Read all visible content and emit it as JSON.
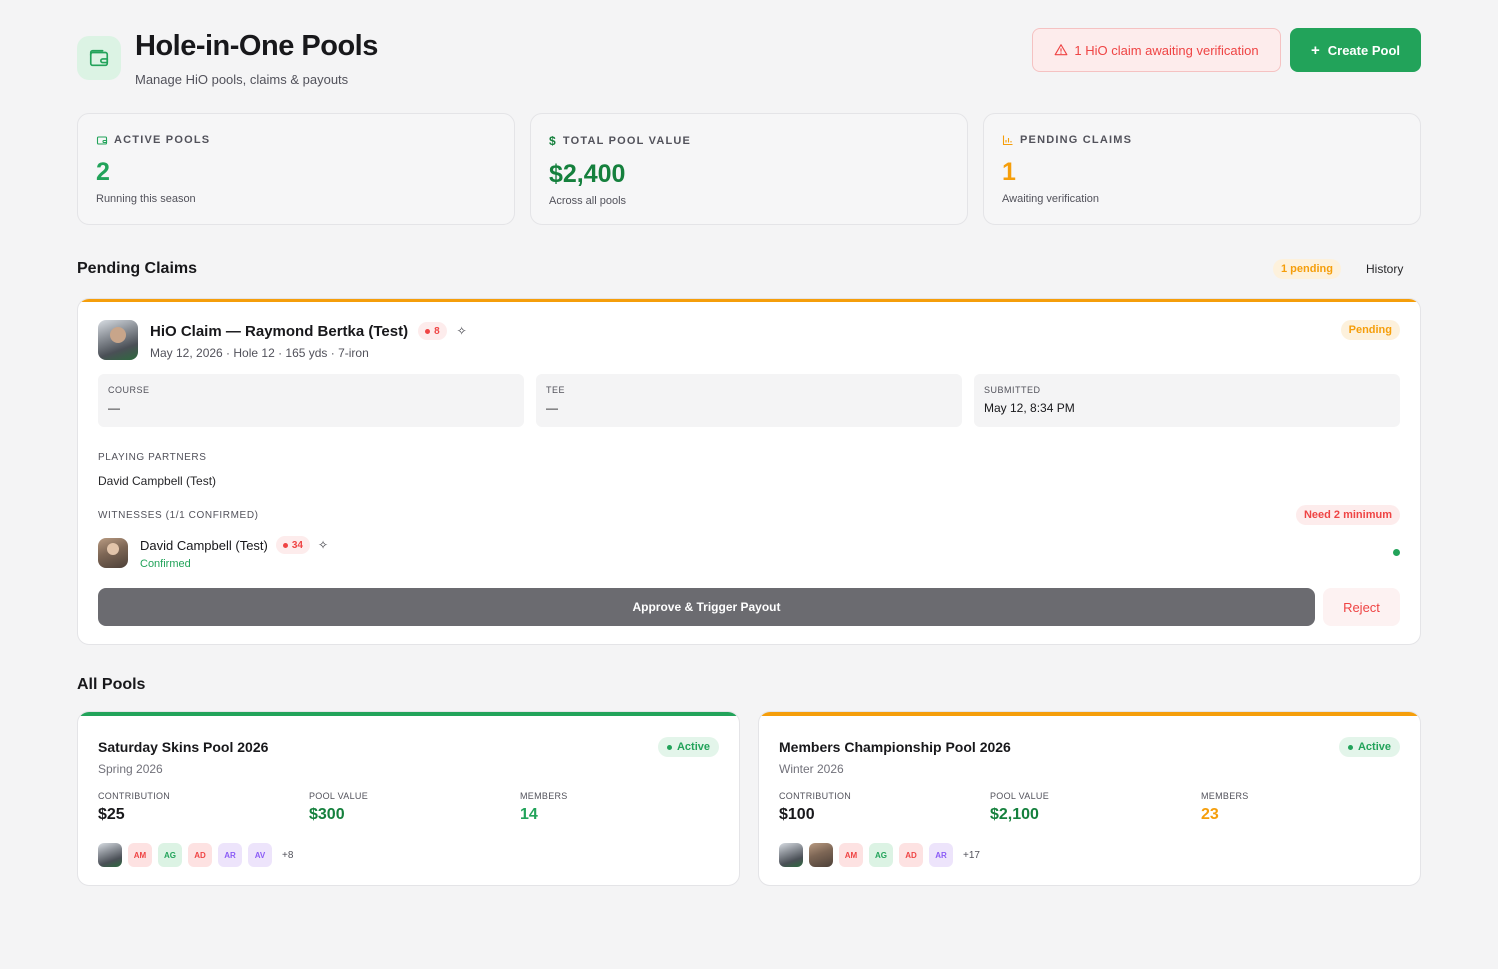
{
  "header": {
    "title": "Hole-in-One Pools",
    "subtitle": "Manage HiO pools, claims & payouts",
    "logo_icon": "wallet-icon",
    "alert_text": "1 HiO claim awaiting verification",
    "alert_icon": "warning-triangle-icon",
    "create_label": "Create Pool",
    "create_icon": "plus-icon"
  },
  "stats": [
    {
      "label": "ACTIVE POOLS",
      "value": "2",
      "caption": "Running this season",
      "icon": "wallet-icon",
      "color": "#22a35a"
    },
    {
      "label": "TOTAL POOL VALUE",
      "value": "$2,400",
      "caption": "Across all pools",
      "icon": "dollar-icon",
      "color": "#15803d"
    },
    {
      "label": "PENDING CLAIMS",
      "value": "1",
      "caption": "Awaiting verification",
      "icon": "bar-chart-icon",
      "color": "#f59e0b"
    }
  ],
  "pending_section": {
    "title": "Pending Claims",
    "badge": "1 pending",
    "history_label": "History"
  },
  "claim": {
    "title": "HiO Claim — Raymond Bertka (Test)",
    "chip_value": "8",
    "meta": "May 12, 2026 · Hole 12 · 165 yds · 7-iron",
    "status": "Pending",
    "info": [
      {
        "label": "COURSE",
        "value": "—"
      },
      {
        "label": "TEE",
        "value": "—"
      },
      {
        "label": "SUBMITTED",
        "value": "May 12, 8:34 PM"
      }
    ],
    "partners_label": "PLAYING PARTNERS",
    "partners": "David Campbell (Test)",
    "witnesses_label": "WITNESSES (1/1 CONFIRMED)",
    "need_min": "Need 2 minimum",
    "witness": {
      "name": "David Campbell (Test)",
      "chip_value": "34",
      "status": "Confirmed"
    },
    "approve_label": "Approve & Trigger Payout",
    "reject_label": "Reject"
  },
  "pools_section": {
    "title": "All Pools"
  },
  "pools": [
    {
      "name": "Saturday Skins Pool 2026",
      "season": "Spring 2026",
      "status": "Active",
      "bar_color": "#22a35a",
      "contribution_label": "CONTRIBUTION",
      "contribution": "$25",
      "pool_value_label": "POOL VALUE",
      "pool_value": "$300",
      "members_label": "MEMBERS",
      "members": "14",
      "members_color": "#22a35a",
      "initials": [
        "AM",
        "AG",
        "AD",
        "AR",
        "AV"
      ],
      "more": "+8"
    },
    {
      "name": "Members Championship Pool 2026",
      "season": "Winter 2026",
      "status": "Active",
      "bar_color": "#f59e0b",
      "contribution_label": "CONTRIBUTION",
      "contribution": "$100",
      "pool_value_label": "POOL VALUE",
      "pool_value": "$2,100",
      "members_label": "MEMBERS",
      "members": "23",
      "members_color": "#f59e0b",
      "initials": [
        "AM",
        "AG",
        "AD",
        "AR"
      ],
      "more": "+17"
    }
  ]
}
